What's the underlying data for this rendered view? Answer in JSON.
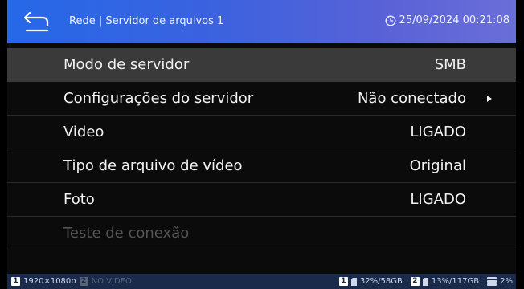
{
  "header": {
    "title": "Rede | Servidor de arquivos 1",
    "datetime": "25/09/2024 00:21:08"
  },
  "menu": {
    "items": [
      {
        "label": "Modo de servidor",
        "value": "SMB",
        "selected": true,
        "arrow": false,
        "enabled": true
      },
      {
        "label": "Configurações do servidor",
        "value": "Não conectado",
        "selected": false,
        "arrow": true,
        "enabled": true
      },
      {
        "label": "Video",
        "value": "LIGADO",
        "selected": false,
        "arrow": false,
        "enabled": true
      },
      {
        "label": "Tipo de arquivo de vídeo",
        "value": "Original",
        "selected": false,
        "arrow": false,
        "enabled": true
      },
      {
        "label": "Foto",
        "value": "LIGADO",
        "selected": false,
        "arrow": false,
        "enabled": true
      },
      {
        "label": "Teste de conexão",
        "value": "",
        "selected": false,
        "arrow": false,
        "enabled": false
      }
    ]
  },
  "statusbar": {
    "output1_badge": "1",
    "output1_resolution": "1920×1080p",
    "output2_badge": "2",
    "output2_text": "NO VIDEO",
    "card1_badge": "1",
    "card1_usage": "32%/58GB",
    "card2_badge": "2",
    "card2_usage": "13%/117GB",
    "storage_usage": "2%"
  },
  "colors": {
    "header_start": "#2568e8",
    "header_end": "#6a6ed8",
    "selected_row": "#3a3a3a",
    "statusbar": "#1a2a4a"
  }
}
